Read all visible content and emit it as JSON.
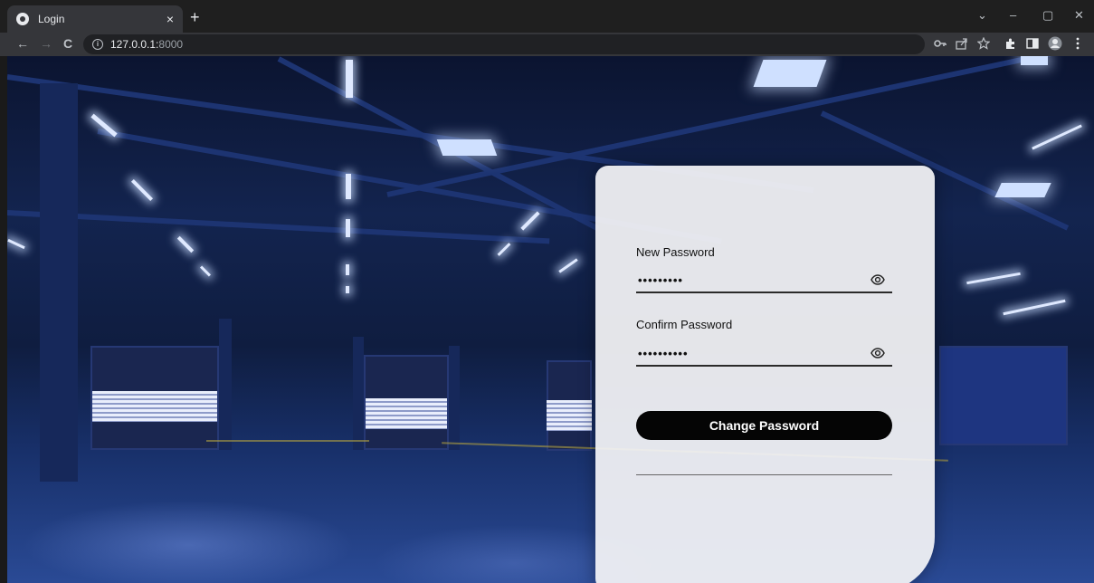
{
  "browser": {
    "tab_title": "Login",
    "tab_close": "×",
    "new_tab": "+",
    "url_host": "127.0.0.1:",
    "url_port": "8000",
    "nav": {
      "back": "←",
      "forward": "→",
      "reload": "C"
    },
    "window": {
      "minimize_chevron": "⌄",
      "minimize": "–",
      "restore": "▢",
      "close": "✕"
    },
    "toolbar_icons": [
      "key-icon",
      "share-icon",
      "star-icon",
      "extensions-icon",
      "sidepanel-icon",
      "profile-icon",
      "menu-icon"
    ]
  },
  "form": {
    "new_password": {
      "label": "New Password",
      "value": "•••••••••"
    },
    "confirm_password": {
      "label": "Confirm Password",
      "value": "••••••••••"
    },
    "submit_label": "Change Password"
  },
  "colors": {
    "button_bg": "#050505",
    "card_bg": "#f4f4f6",
    "underline": "#2a2a2a"
  }
}
